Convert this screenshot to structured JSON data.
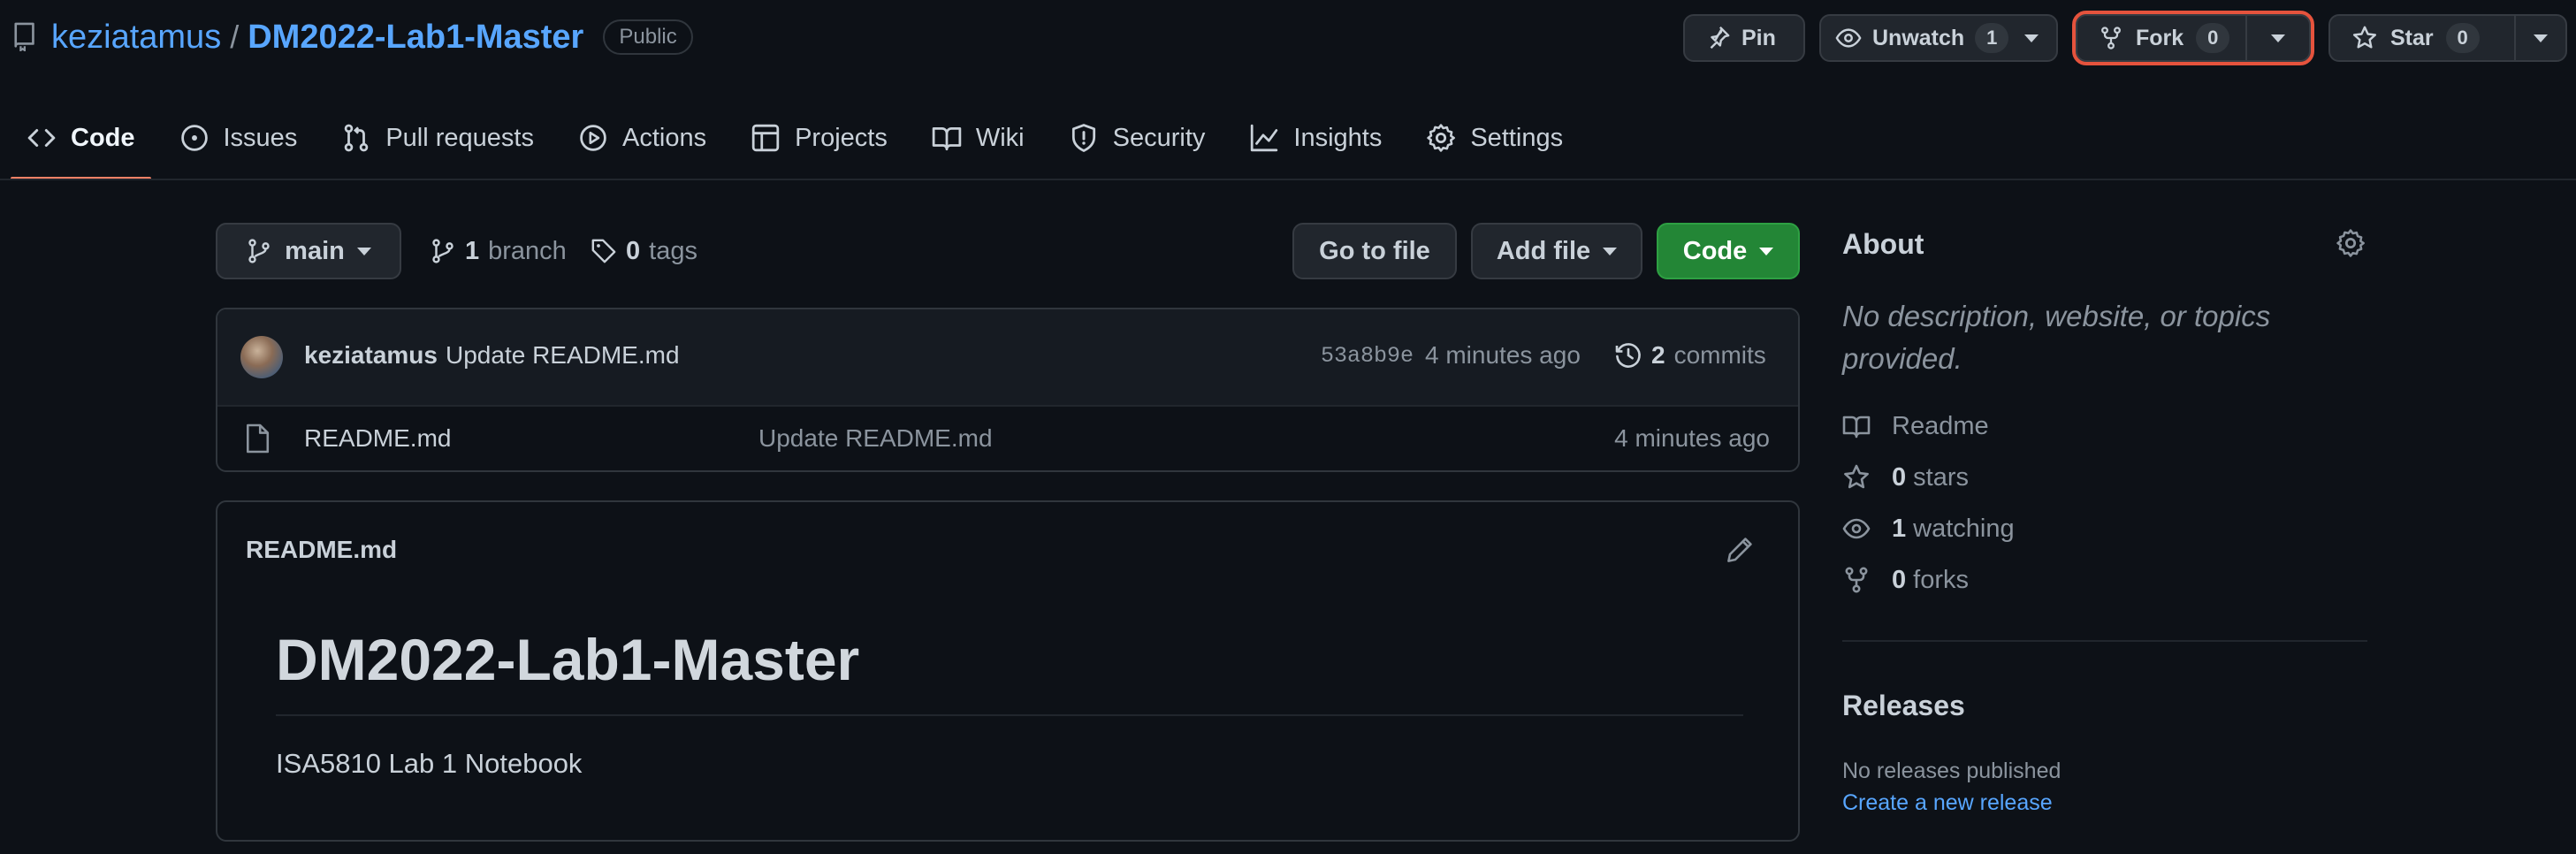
{
  "header": {
    "owner": "keziatamus",
    "separator": "/",
    "repo": "DM2022-Lab1-Master",
    "visibility": "Public",
    "pin_label": "Pin",
    "watch_label": "Unwatch",
    "watch_count": "1",
    "fork_label": "Fork",
    "fork_count": "0",
    "star_label": "Star",
    "star_count": "0"
  },
  "tabs": [
    {
      "label": "Code",
      "icon": "code-icon",
      "selected": true
    },
    {
      "label": "Issues",
      "icon": "issue-icon"
    },
    {
      "label": "Pull requests",
      "icon": "pull-request-icon"
    },
    {
      "label": "Actions",
      "icon": "play-icon"
    },
    {
      "label": "Projects",
      "icon": "table-icon"
    },
    {
      "label": "Wiki",
      "icon": "book-icon"
    },
    {
      "label": "Security",
      "icon": "shield-icon"
    },
    {
      "label": "Insights",
      "icon": "graph-icon"
    },
    {
      "label": "Settings",
      "icon": "gear-icon"
    }
  ],
  "filenav": {
    "branch": "main",
    "branch_count": "1",
    "branch_label": "branch",
    "tag_count": "0",
    "tag_label": "tags",
    "go_to_file": "Go to file",
    "add_file": "Add file",
    "code": "Code"
  },
  "commit": {
    "author": "keziatamus",
    "message": "Update README.md",
    "sha": "53a8b9e",
    "time": "4 minutes ago",
    "commit_count": "2",
    "commit_label": "commits"
  },
  "files": [
    {
      "name": "README.md",
      "message": "Update README.md",
      "time": "4 minutes ago"
    }
  ],
  "readme": {
    "filename": "README.md",
    "heading": "DM2022-Lab1-Master",
    "body": "ISA5810 Lab 1 Notebook"
  },
  "sidebar": {
    "about_title": "About",
    "description": "No description, website, or topics provided.",
    "readme_label": "Readme",
    "stars_count": "0",
    "stars_label": "stars",
    "watching_count": "1",
    "watching_label": "watching",
    "forks_count": "0",
    "forks_label": "forks",
    "releases_title": "Releases",
    "no_releases": "No releases published",
    "create_release": "Create a new release"
  },
  "colors": {
    "background": "#0d1117",
    "link": "#58a6ff",
    "primary_button": "#238636",
    "selected_tab_underline": "#f78166",
    "focus_highlight": "#e5533d"
  }
}
